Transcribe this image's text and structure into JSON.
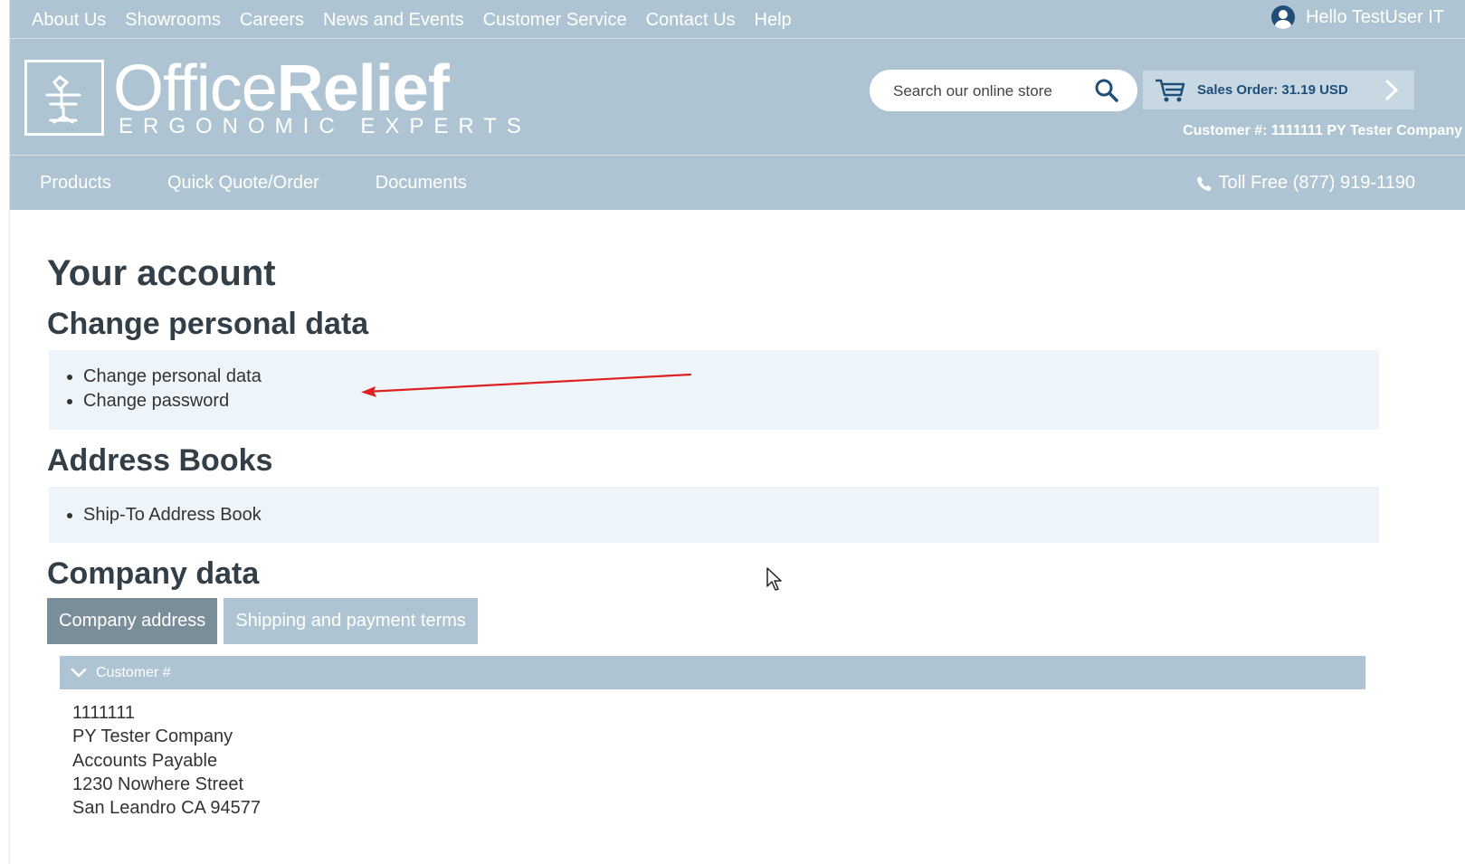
{
  "topbar": {
    "links": [
      "About Us",
      "Showrooms",
      "Careers",
      "News and Events",
      "Customer Service",
      "Contact Us",
      "Help"
    ],
    "greeting": "Hello TestUser IT"
  },
  "logo": {
    "word_light": "Office",
    "word_bold": "Relief",
    "tagline": "ERGONOMIC EXPERTS"
  },
  "search": {
    "placeholder": "Search our online store"
  },
  "cart": {
    "label": "Sales Order: 31.19 USD"
  },
  "customer_line": "Customer #: 1111111 PY Tester Company",
  "nav": {
    "links": [
      "Products",
      "Quick Quote/Order",
      "Documents"
    ],
    "tollfree": "Toll Free (877) 919-1190"
  },
  "page": {
    "title": "Your account",
    "personal_heading": "Change personal data",
    "personal_links": [
      "Change personal data",
      "Change password"
    ],
    "address_heading": "Address Books",
    "address_links": [
      "Ship-To Address Book"
    ],
    "company_heading": "Company data",
    "tabs": [
      "Company address",
      "Shipping and payment terms"
    ],
    "accordion_title": "Customer #",
    "address_lines": [
      "1111111",
      "PY Tester Company",
      "Accounts Payable",
      "1230 Nowhere Street",
      "San Leandro CA 94577"
    ]
  },
  "colors": {
    "header_bg": "#aec4d2",
    "brand_dark": "#1f4e79",
    "active_tab": "#7a8e9a",
    "panel_bg": "#eef5fa",
    "annotation_arrow": "#e02020"
  },
  "icons": [
    "user-icon",
    "search-icon",
    "cart-icon",
    "chevron-right-icon",
    "phone-icon",
    "chevron-down-icon",
    "mouse-cursor"
  ]
}
